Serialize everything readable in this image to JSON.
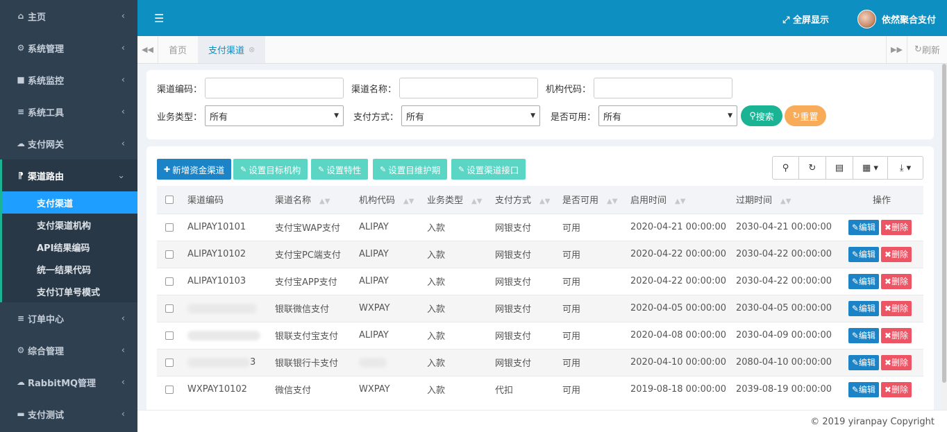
{
  "sidebar": {
    "items": [
      {
        "icon": "home-icon",
        "glyph": "⌂",
        "label": "主页"
      },
      {
        "icon": "gear-icon",
        "glyph": "⚙",
        "label": "系统管理"
      },
      {
        "icon": "video-icon",
        "glyph": "■",
        "label": "系统监控"
      },
      {
        "icon": "list-icon",
        "glyph": "≡",
        "label": "系统工具"
      },
      {
        "icon": "cloud-icon",
        "glyph": "☁",
        "label": "支付网关"
      },
      {
        "icon": "route-icon",
        "glyph": "⁋",
        "label": "渠道路由"
      },
      {
        "icon": "list-icon",
        "glyph": "≡",
        "label": "订单中心"
      },
      {
        "icon": "gears-icon",
        "glyph": "⚙",
        "label": "综合管理"
      },
      {
        "icon": "cloud-icon",
        "glyph": "☁",
        "label": "RabbitMQ管理"
      },
      {
        "icon": "card-icon",
        "glyph": "▬",
        "label": "支付测试"
      }
    ],
    "sub_items": [
      "支付渠道",
      "支付渠道机构",
      "API结果编码",
      "统一结果代码",
      "支付订单号模式"
    ]
  },
  "topbar": {
    "fullscreen_label": "全屏显示",
    "username": "依然聚合支付"
  },
  "tabs": {
    "home": "首页",
    "active": "支付渠道",
    "refresh": "刷新"
  },
  "search": {
    "channel_code_label": "渠道编码：",
    "channel_name_label": "渠道名称：",
    "org_code_label": "机构代码：",
    "biz_type_label": "业务类型：",
    "pay_method_label": "支付方式：",
    "enabled_label": "是否可用：",
    "biz_type_value": "所有",
    "pay_method_value": "所有",
    "enabled_value": "所有",
    "search_button": "搜索",
    "reset_button": "重置"
  },
  "toolbar": {
    "add": "新增资金渠道",
    "set_org": "设置目标机构",
    "set_feature": "设置特性",
    "set_maint": "设置目维护期",
    "set_iface": "设置渠道接口"
  },
  "table": {
    "headers": [
      "渠道编码",
      "渠道名称",
      "机构代码",
      "业务类型",
      "支付方式",
      "是否可用",
      "启用时间",
      "过期时间",
      "操作"
    ],
    "edit_label": "编辑",
    "delete_label": "删除",
    "rows": [
      [
        "ALIPAY10101",
        "支付宝WAP支付",
        "ALIPAY",
        "入款",
        "网银支付",
        "可用",
        "2020-04-21 00:00:00",
        "2030-04-21 00:00:00"
      ],
      [
        "ALIPAY10102",
        "支付宝PC端支付",
        "ALIPAY",
        "入款",
        "网银支付",
        "可用",
        "2020-04-22 00:00:00",
        "2030-04-22 00:00:00"
      ],
      [
        "ALIPAY10103",
        "支付宝APP支付",
        "ALIPAY",
        "入款",
        "网银支付",
        "可用",
        "2020-04-22 00:00:00",
        "2030-04-22 00:00:00"
      ],
      [
        "",
        "银联微信支付",
        "WXPAY",
        "入款",
        "网银支付",
        "可用",
        "2020-04-05 00:00:00",
        "2030-04-05 00:00:00"
      ],
      [
        "",
        "银联支付宝支付",
        "ALIPAY",
        "入款",
        "网银支付",
        "可用",
        "2020-04-08 00:00:00",
        "2030-04-09 00:00:00"
      ],
      [
        "3",
        "银联银行卡支付",
        "",
        "入款",
        "网银支付",
        "可用",
        "2020-04-10 00:00:00",
        "2080-04-10 00:00:00"
      ],
      [
        "WXPAY10102",
        "微信支付",
        "WXPAY",
        "入款",
        "代扣",
        "可用",
        "2019-08-18 00:00:00",
        "2039-08-19 00:00:00"
      ]
    ]
  },
  "footer": {
    "copyright": "© 2019 yiranpay Copyright"
  },
  "colors": {
    "sidebar": "#2f4050",
    "topbar": "#0e8fc2",
    "active_sub": "#1e9fff",
    "primary": "#1c84c6",
    "teal": "#5bc0de",
    "success": "#1ab394",
    "warning": "#f8ac59",
    "danger": "#ed5565"
  }
}
